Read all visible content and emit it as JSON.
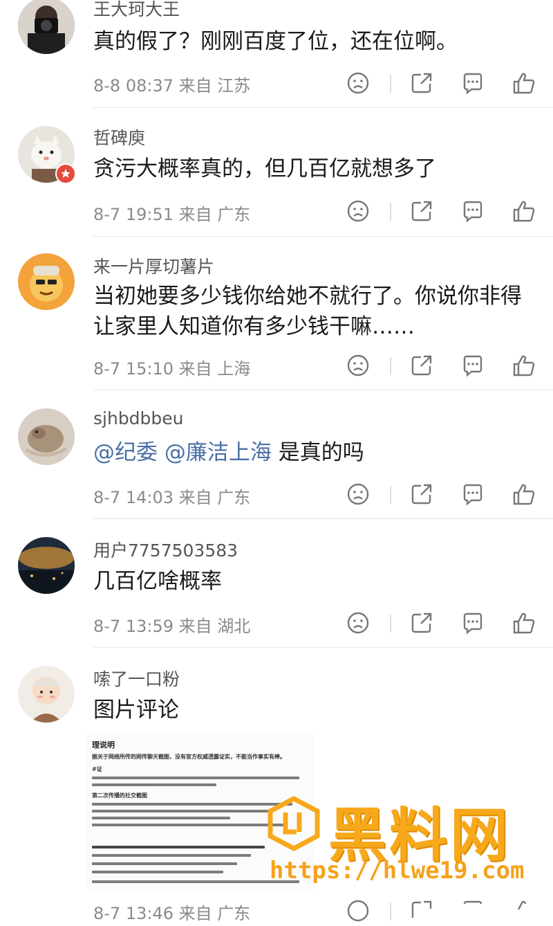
{
  "comments": [
    {
      "user": "王大珂大王",
      "text": "真的假了？刚刚百度了位，还在位啊。",
      "time": "8-8 08:37",
      "location": "来自 江苏"
    },
    {
      "user": "哲碑庾",
      "text": "贪污大概率真的，但几百亿就想多了",
      "time": "8-7 19:51",
      "location": "来自 广东"
    },
    {
      "user": "来一片厚切薯片",
      "text": "当初她要多少钱你给她不就行了。你说你非得让家里人知道你有多少钱干嘛……",
      "time": "8-7 15:10",
      "location": "来自 上海"
    },
    {
      "user": "sjhbdbbeu",
      "mention1": "@纪委",
      "mention2": "@廉洁上海",
      "text": " 是真的吗",
      "time": "8-7 14:03",
      "location": "来自 广东"
    },
    {
      "user": "用户7757503583",
      "text": "几百亿啥概率",
      "time": "8-7 13:59",
      "location": "来自 湖北"
    },
    {
      "user": "嗦了一口粉",
      "text": "图片评论",
      "time": "8-7 13:46",
      "location": "来自 广东"
    }
  ],
  "image_doc": {
    "title": "理说明",
    "line1": "据关于网络所传的网传聊天截图，没有官方权威透露证实，不能当作事实有棒。",
    "heading2": "#证",
    "heading3": "第二次传播的社交截图"
  },
  "watermark": {
    "brand": "黑料网",
    "url": "https://hlwe19.com"
  },
  "colors": {
    "mention": "#4a6fa5",
    "watermark": "#f7a91b"
  }
}
